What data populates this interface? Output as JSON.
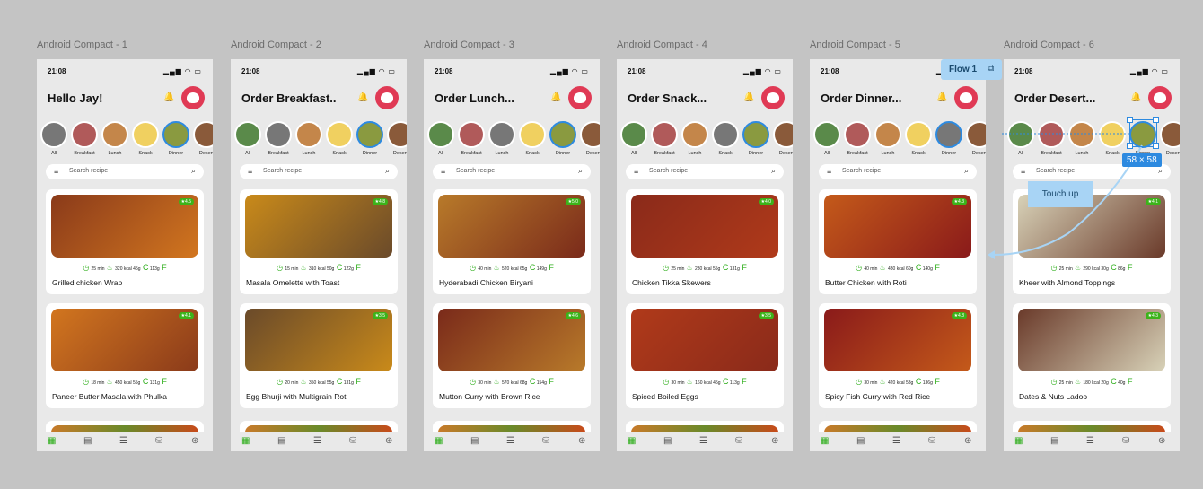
{
  "status_time": "21:08",
  "status_icons": "▂▄▆ ◠ ▭",
  "search_placeholder": "Search recipe",
  "categories": [
    "All",
    "Breakfast",
    "Lunch",
    "Snack",
    "Dinner",
    "Desert"
  ],
  "frames": [
    {
      "label": "Android Compact - 1",
      "title": "Hello Jay!",
      "gray_cat": 0,
      "cards": [
        {
          "name": "Grilled chicken Wrap",
          "rating": "4.5",
          "time": "25 min",
          "kcal": "320 kcal",
          "carbs": "45g",
          "fat": "113g"
        },
        {
          "name": "Paneer Butter Masala with Phulka",
          "rating": "4.1",
          "time": "18 min",
          "kcal": "450 kcal",
          "carbs": "55g",
          "fat": "131g"
        }
      ]
    },
    {
      "label": "Android Compact - 2",
      "title": "Order Breakfast..",
      "gray_cat": 1,
      "cards": [
        {
          "name": "Masala Omelette with Toast",
          "rating": "4.8",
          "time": "15 min",
          "kcal": "310 kcal",
          "carbs": "50g",
          "fat": "122g"
        },
        {
          "name": "Egg Bhurji with Multigrain Roti",
          "rating": "3.5",
          "time": "20 min",
          "kcal": "350 kcal",
          "carbs": "55g",
          "fat": "131g"
        }
      ]
    },
    {
      "label": "Android Compact - 3",
      "title": "Order Lunch...",
      "gray_cat": 2,
      "cards": [
        {
          "name": "Hyderabadi Chicken Biryani",
          "rating": "5.0",
          "time": "40 min",
          "kcal": "520 kcal",
          "carbs": "65g",
          "fat": "149g"
        },
        {
          "name": "Mutton Curry with Brown Rice",
          "rating": "4.6",
          "time": "30 min",
          "kcal": "570 kcal",
          "carbs": "68g",
          "fat": "154g"
        }
      ]
    },
    {
      "label": "Android Compact - 4",
      "title": "Order Snack...",
      "gray_cat": 3,
      "cards": [
        {
          "name": "Chicken Tikka Skewers",
          "rating": "4.0",
          "time": "25 min",
          "kcal": "280 kcal",
          "carbs": "55g",
          "fat": "131g"
        },
        {
          "name": "Spiced Boiled Eggs",
          "rating": "3.5",
          "time": "30 min",
          "kcal": "160 kcal",
          "carbs": "45g",
          "fat": "113g"
        }
      ]
    },
    {
      "label": "Android Compact - 5",
      "title": "Order Dinner...",
      "gray_cat": 4,
      "cards": [
        {
          "name": "Butter Chicken with Roti",
          "rating": "4.3",
          "time": "40 min",
          "kcal": "480 kcal",
          "carbs": "60g",
          "fat": "140g"
        },
        {
          "name": "Spicy Fish Curry with Red Rice",
          "rating": "4.8",
          "time": "30 min",
          "kcal": "420 kcal",
          "carbs": "58g",
          "fat": "136g"
        }
      ]
    },
    {
      "label": "Android Compact - 6",
      "title": "Order Desert...",
      "gray_cat": -1,
      "cards": [
        {
          "name": "Kheer with Almond Toppings",
          "rating": "4.1",
          "time": "25 min",
          "kcal": "290 kcal",
          "carbs": "30g",
          "fat": "86g"
        },
        {
          "name": "Dates & Nuts Ladoo",
          "rating": "4.3",
          "time": "25 min",
          "kcal": "180 kcal",
          "carbs": "20g",
          "fat": "40g"
        }
      ]
    }
  ],
  "flow_label": "Flow 1",
  "size_label": "58 × 58",
  "touch_label": "Touch up",
  "colors": {
    "accent_green": "#2fae1c",
    "rating_green": "#3cb31a",
    "avatar_red": "#e03a55",
    "selection_blue": "#2d8ae0",
    "proto_blue": "#a8d4f5"
  }
}
